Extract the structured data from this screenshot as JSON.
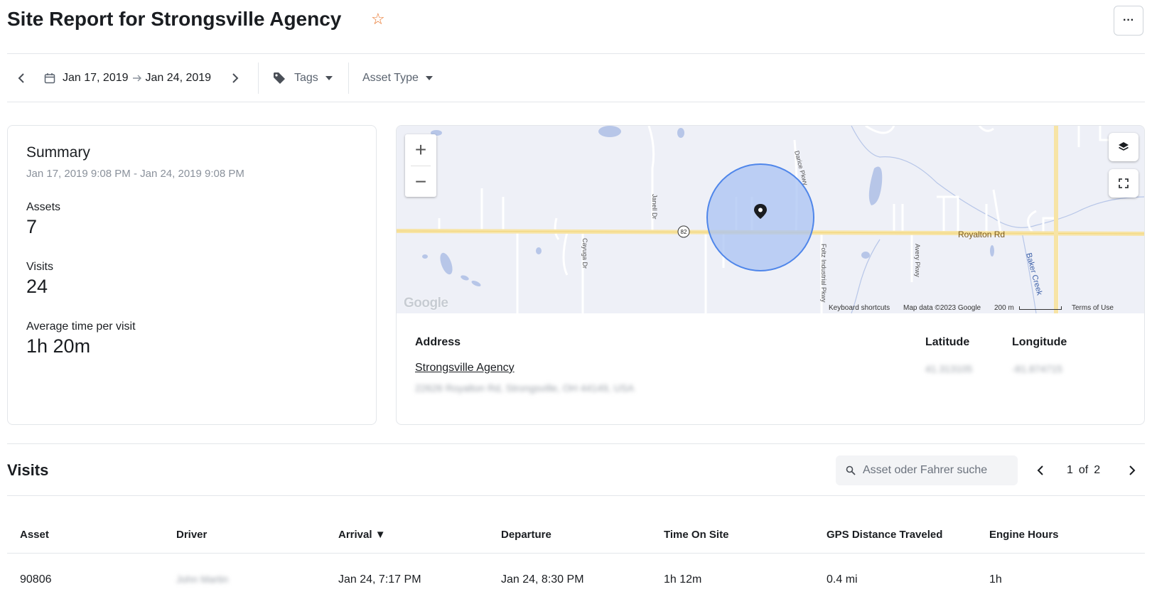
{
  "header": {
    "title": "Site Report for Strongsville Agency",
    "more_label": "···"
  },
  "filters": {
    "date_start": "Jan 17, 2019",
    "date_end": "Jan 24, 2019",
    "tags_label": "Tags",
    "asset_type_label": "Asset Type"
  },
  "summary": {
    "title": "Summary",
    "range": "Jan 17, 2019 9:08 PM - Jan 24, 2019 9:08 PM",
    "stats": [
      {
        "label": "Assets",
        "value": "7"
      },
      {
        "label": "Visits",
        "value": "24"
      },
      {
        "label": "Average time per visit",
        "value": "1h 20m"
      }
    ]
  },
  "map": {
    "roads": {
      "royalton": "Royalton Rd",
      "route": "82",
      "janell": "Janell Dr",
      "cayuga": "Cayuga Dr",
      "darice": "Darice Pkwy",
      "foltz": "Foltz Industrial Pkwy",
      "avery": "Avery Pkwy",
      "baker": "Baker Creek"
    },
    "logo": "Google",
    "attribution": {
      "shortcuts": "Keyboard shortcuts",
      "data": "Map data ©2023 Google",
      "scale": "200 m",
      "terms": "Terms of Use"
    },
    "zoom_in": "+",
    "zoom_out": "−"
  },
  "location": {
    "address_header": "Address",
    "latitude_header": "Latitude",
    "longitude_header": "Longitude",
    "site_name": "Strongsville Agency",
    "street_address": "22626 Royalton Rd, Strongsville, OH 44149, USA",
    "latitude": "41.313105",
    "longitude": "-81.874715"
  },
  "visits": {
    "title": "Visits",
    "search_placeholder": "Asset oder Fahrer suche",
    "page_current": "1",
    "page_of": "of",
    "page_total": "2",
    "columns": [
      "Asset",
      "Driver",
      "Arrival ▼",
      "Departure",
      "Time On Site",
      "GPS Distance Traveled",
      "Engine Hours"
    ],
    "rows": [
      {
        "asset": "90806",
        "driver": "John Martin",
        "arrival": "Jan 24, 7:17 PM",
        "departure": "Jan 24, 8:30 PM",
        "time_on_site": "1h 12m",
        "distance": "0.4 mi",
        "engine_hours": "1h"
      }
    ]
  }
}
